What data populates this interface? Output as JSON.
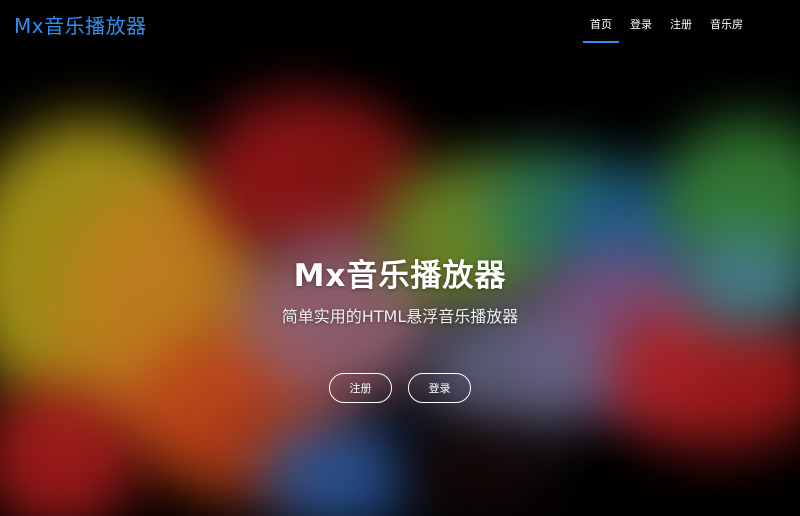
{
  "navbar": {
    "brand": "Mx音乐播放器",
    "links": [
      {
        "label": "首页",
        "active": true
      },
      {
        "label": "登录",
        "active": false
      },
      {
        "label": "注册",
        "active": false
      },
      {
        "label": "音乐房",
        "active": false
      }
    ]
  },
  "hero": {
    "title": "Mx音乐播放器",
    "subtitle": "简单实用的HTML悬浮音乐播放器",
    "buttons": {
      "register": "注册",
      "login": "登录"
    }
  },
  "colors": {
    "accent": "#2f8ff0",
    "background": "#000000"
  }
}
